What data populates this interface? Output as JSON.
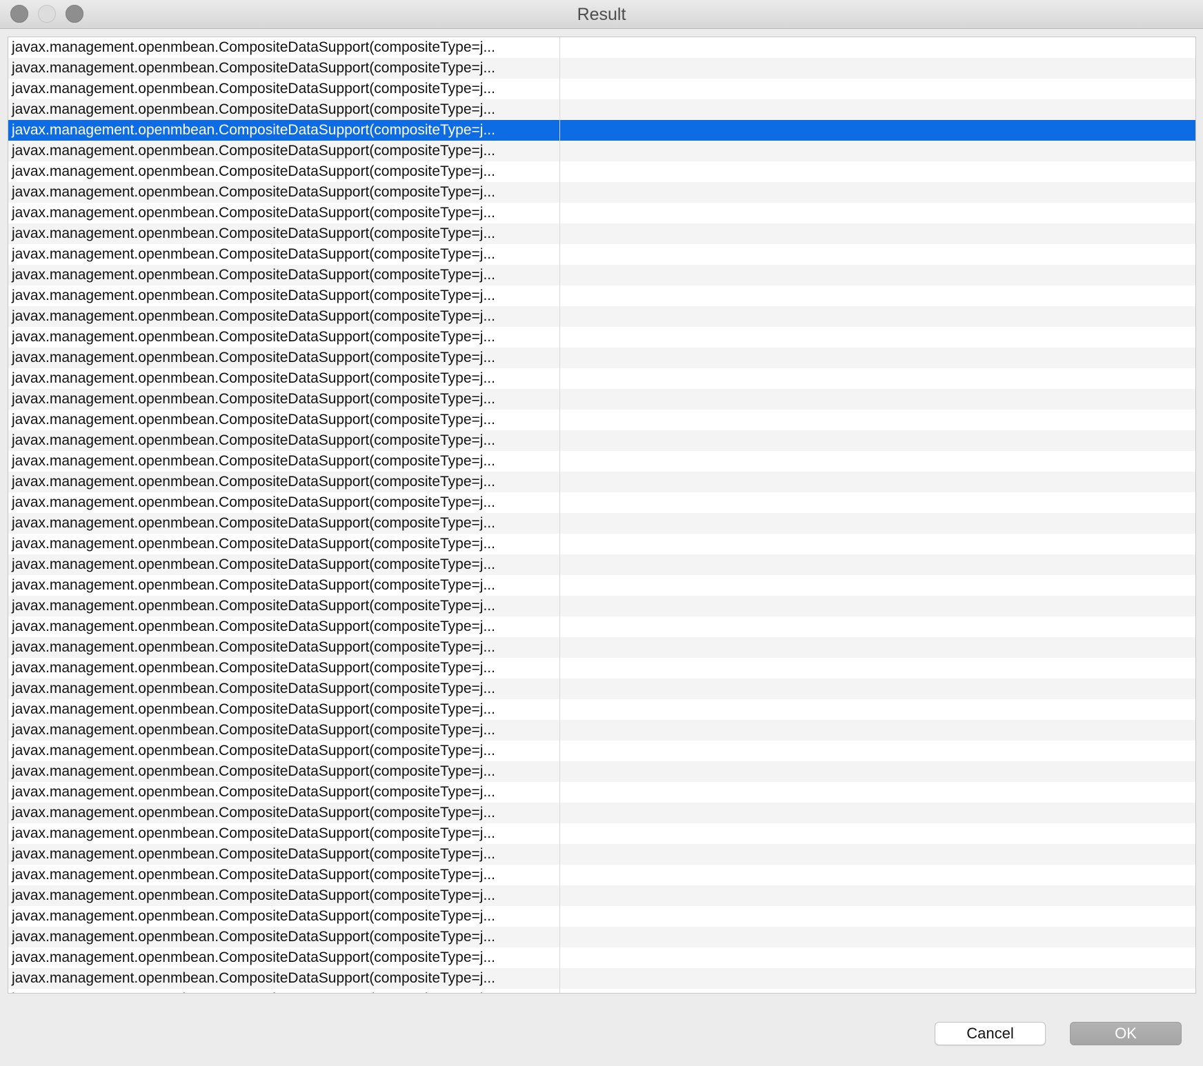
{
  "window": {
    "title": "Result"
  },
  "table": {
    "selected_index": 4,
    "rows": [
      {
        "key": "javax.management.openmbean.CompositeDataSupport(compositeType=j...",
        "value": ""
      },
      {
        "key": "javax.management.openmbean.CompositeDataSupport(compositeType=j...",
        "value": ""
      },
      {
        "key": "javax.management.openmbean.CompositeDataSupport(compositeType=j...",
        "value": ""
      },
      {
        "key": "javax.management.openmbean.CompositeDataSupport(compositeType=j...",
        "value": ""
      },
      {
        "key": "javax.management.openmbean.CompositeDataSupport(compositeType=j...",
        "value": ""
      },
      {
        "key": "javax.management.openmbean.CompositeDataSupport(compositeType=j...",
        "value": ""
      },
      {
        "key": "javax.management.openmbean.CompositeDataSupport(compositeType=j...",
        "value": ""
      },
      {
        "key": "javax.management.openmbean.CompositeDataSupport(compositeType=j...",
        "value": ""
      },
      {
        "key": "javax.management.openmbean.CompositeDataSupport(compositeType=j...",
        "value": ""
      },
      {
        "key": "javax.management.openmbean.CompositeDataSupport(compositeType=j...",
        "value": ""
      },
      {
        "key": "javax.management.openmbean.CompositeDataSupport(compositeType=j...",
        "value": ""
      },
      {
        "key": "javax.management.openmbean.CompositeDataSupport(compositeType=j...",
        "value": ""
      },
      {
        "key": "javax.management.openmbean.CompositeDataSupport(compositeType=j...",
        "value": ""
      },
      {
        "key": "javax.management.openmbean.CompositeDataSupport(compositeType=j...",
        "value": ""
      },
      {
        "key": "javax.management.openmbean.CompositeDataSupport(compositeType=j...",
        "value": ""
      },
      {
        "key": "javax.management.openmbean.CompositeDataSupport(compositeType=j...",
        "value": ""
      },
      {
        "key": "javax.management.openmbean.CompositeDataSupport(compositeType=j...",
        "value": ""
      },
      {
        "key": "javax.management.openmbean.CompositeDataSupport(compositeType=j...",
        "value": ""
      },
      {
        "key": "javax.management.openmbean.CompositeDataSupport(compositeType=j...",
        "value": ""
      },
      {
        "key": "javax.management.openmbean.CompositeDataSupport(compositeType=j...",
        "value": ""
      },
      {
        "key": "javax.management.openmbean.CompositeDataSupport(compositeType=j...",
        "value": ""
      },
      {
        "key": "javax.management.openmbean.CompositeDataSupport(compositeType=j...",
        "value": ""
      },
      {
        "key": "javax.management.openmbean.CompositeDataSupport(compositeType=j...",
        "value": ""
      },
      {
        "key": "javax.management.openmbean.CompositeDataSupport(compositeType=j...",
        "value": ""
      },
      {
        "key": "javax.management.openmbean.CompositeDataSupport(compositeType=j...",
        "value": ""
      },
      {
        "key": "javax.management.openmbean.CompositeDataSupport(compositeType=j...",
        "value": ""
      },
      {
        "key": "javax.management.openmbean.CompositeDataSupport(compositeType=j...",
        "value": ""
      },
      {
        "key": "javax.management.openmbean.CompositeDataSupport(compositeType=j...",
        "value": ""
      },
      {
        "key": "javax.management.openmbean.CompositeDataSupport(compositeType=j...",
        "value": ""
      },
      {
        "key": "javax.management.openmbean.CompositeDataSupport(compositeType=j...",
        "value": ""
      },
      {
        "key": "javax.management.openmbean.CompositeDataSupport(compositeType=j...",
        "value": ""
      },
      {
        "key": "javax.management.openmbean.CompositeDataSupport(compositeType=j...",
        "value": ""
      },
      {
        "key": "javax.management.openmbean.CompositeDataSupport(compositeType=j...",
        "value": ""
      },
      {
        "key": "javax.management.openmbean.CompositeDataSupport(compositeType=j...",
        "value": ""
      },
      {
        "key": "javax.management.openmbean.CompositeDataSupport(compositeType=j...",
        "value": ""
      },
      {
        "key": "javax.management.openmbean.CompositeDataSupport(compositeType=j...",
        "value": ""
      },
      {
        "key": "javax.management.openmbean.CompositeDataSupport(compositeType=j...",
        "value": ""
      },
      {
        "key": "javax.management.openmbean.CompositeDataSupport(compositeType=j...",
        "value": ""
      },
      {
        "key": "javax.management.openmbean.CompositeDataSupport(compositeType=j...",
        "value": ""
      },
      {
        "key": "javax.management.openmbean.CompositeDataSupport(compositeType=j...",
        "value": ""
      },
      {
        "key": "javax.management.openmbean.CompositeDataSupport(compositeType=j...",
        "value": ""
      },
      {
        "key": "javax.management.openmbean.CompositeDataSupport(compositeType=j...",
        "value": ""
      },
      {
        "key": "javax.management.openmbean.CompositeDataSupport(compositeType=j...",
        "value": ""
      },
      {
        "key": "javax.management.openmbean.CompositeDataSupport(compositeType=j...",
        "value": ""
      },
      {
        "key": "javax.management.openmbean.CompositeDataSupport(compositeType=j...",
        "value": ""
      },
      {
        "key": "javax.management.openmbean.CompositeDataSupport(compositeType=j...",
        "value": ""
      },
      {
        "key": "javax.management.openmbean.CompositeDataSupport(compositeType=j...",
        "value": ""
      }
    ]
  },
  "buttons": {
    "cancel_label": "Cancel",
    "ok_label": "OK"
  },
  "colors": {
    "selection": "#0d6be3",
    "row_stripe": "#f4f4f4",
    "window_bg": "#ececec"
  }
}
